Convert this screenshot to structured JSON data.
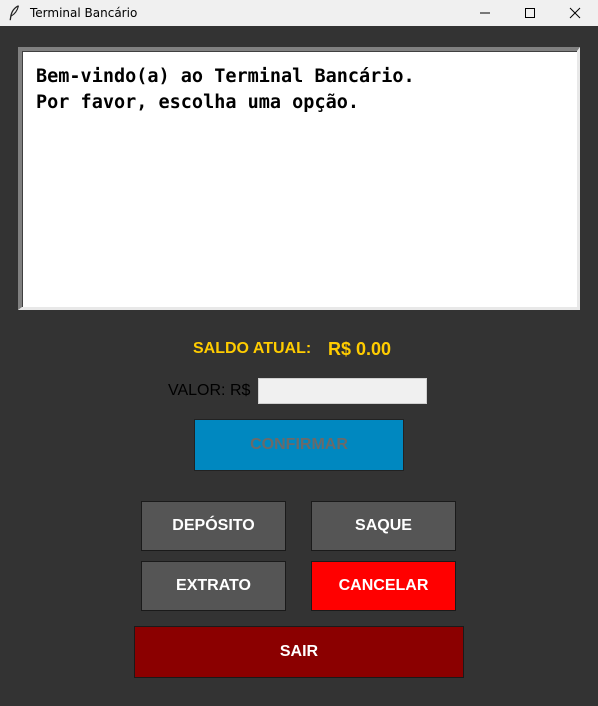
{
  "window": {
    "title": "Terminal Bancário",
    "icons": {
      "app": "feather-icon",
      "minimize": "minimize-icon",
      "maximize": "maximize-icon",
      "close": "close-icon"
    }
  },
  "display": {
    "lines": [
      "Bem-vindo(a) ao Terminal Bancário.",
      "Por favor, escolha uma opção."
    ]
  },
  "saldo": {
    "label": "SALDO ATUAL:",
    "value": "R$ 0.00"
  },
  "valor": {
    "label": "VALOR: R$",
    "value": "",
    "placeholder": ""
  },
  "buttons": {
    "confirmar": "CONFIRMAR",
    "deposito": "DEPÓSITO",
    "saque": "SAQUE",
    "extrato": "EXTRATO",
    "cancelar": "CANCELAR",
    "sair": "SAIR"
  },
  "colors": {
    "background": "#333333",
    "saldo": "#ffcc00",
    "confirmar": "#0088c0",
    "neutral_button": "#555555",
    "cancelar": "#ff0000",
    "sair": "#8b0000"
  }
}
